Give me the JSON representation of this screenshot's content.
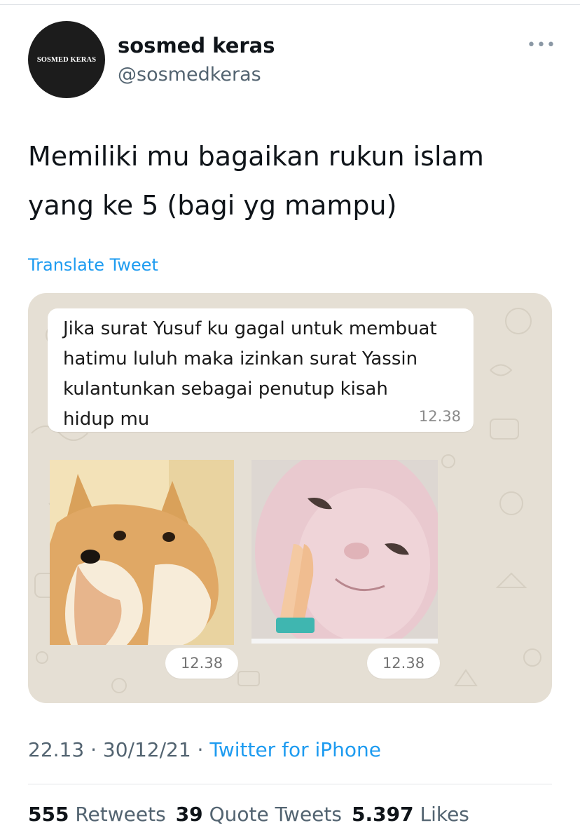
{
  "profile": {
    "avatar_text": "SOSMED KERAS",
    "name": "sosmed keras",
    "handle": "@sosmedkeras"
  },
  "more_icon": "more-horizontal-icon",
  "tweet": {
    "line1": "Memiliki mu bagaikan rukun islam",
    "line2": "yang ke 5 (bagi yg mampu)",
    "translate_label": "Translate Tweet"
  },
  "chat": {
    "message_lines": [
      "Jika surat Yusuf ku gagal untuk membuat",
      "hatimu luluh maka izinkan surat Yassin",
      "kulantunkan sebagai penutup kisah",
      "hidup mu"
    ],
    "message_time": "12.38",
    "image1_time": "12.38",
    "image2_time": "12.38"
  },
  "meta": {
    "time": "22.13",
    "date": "30/12/21",
    "separator": " · ",
    "source": "Twitter for iPhone"
  },
  "stats": {
    "retweets_count": "555",
    "retweets_label": "Retweets",
    "quotes_count": "39",
    "quotes_label": "Quote Tweets",
    "likes_count": "5.397",
    "likes_label": "Likes"
  },
  "colors": {
    "link": "#1d9bf0",
    "secondary_text": "#536471",
    "chat_wallpaper": "#e5dfd4"
  }
}
